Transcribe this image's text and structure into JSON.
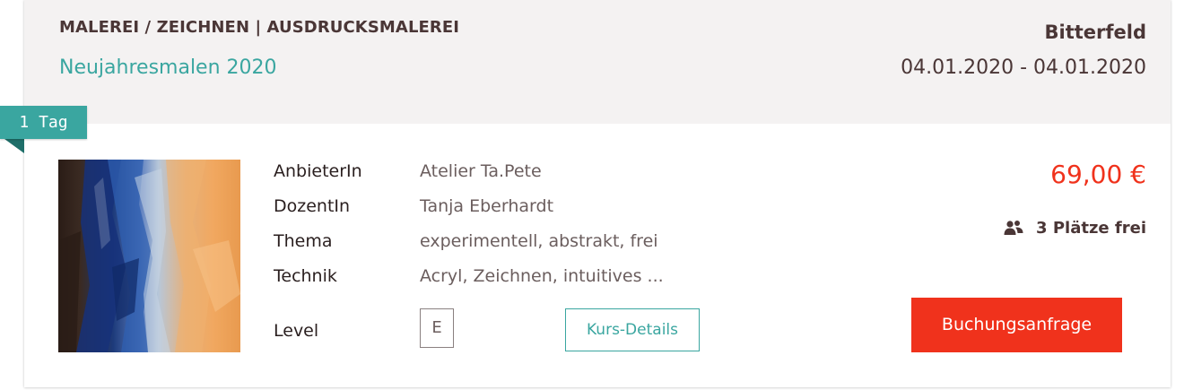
{
  "header": {
    "category": "MALEREI / ZEICHNEN | AUSDRUCKSMALEREI",
    "title": "Neujahresmalen 2020",
    "location": "Bitterfeld",
    "dates": "04.01.2020 - 04.01.2020"
  },
  "ribbon": {
    "label": "1 Tag"
  },
  "details": {
    "rows": [
      {
        "label": "AnbieterIn",
        "value": "Atelier Ta.Pete"
      },
      {
        "label": "DozentIn",
        "value": "Tanja Eberhardt"
      },
      {
        "label": "Thema",
        "value": "experimentell, abstrakt, frei"
      },
      {
        "label": "Technik",
        "value": "Acryl, Zeichnen, intuitives ..."
      }
    ],
    "level_label": "Level",
    "level_value": "E",
    "details_button": "Kurs-Details"
  },
  "offer": {
    "price": "69,00 €",
    "seats": "3 Plätze frei",
    "seats_icon": "people-icon",
    "book_button": "Buchungsanfrage"
  },
  "colors": {
    "accent_teal": "#3aa6a0",
    "price_red": "#f0321c",
    "text_dark": "#4a3636",
    "header_bg": "#f4f2f2"
  }
}
